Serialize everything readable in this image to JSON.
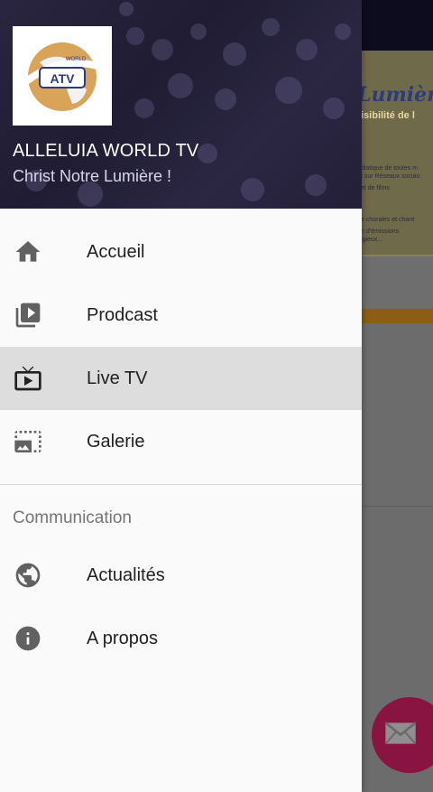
{
  "header": {
    "title": "ALLELUIA WORLD TV",
    "subtitle": "Christ Notre Lumière !",
    "logo_text": "ATV",
    "logo_small_text": "WORLD"
  },
  "menu": {
    "primary": [
      {
        "label": "Accueil",
        "icon": "home-icon"
      },
      {
        "label": "Prodcast",
        "icon": "video-library-icon"
      },
      {
        "label": "Live TV",
        "icon": "live-tv-icon",
        "active": true
      },
      {
        "label": "Galerie",
        "icon": "photo-size-select-icon"
      }
    ],
    "section_title": "Communication",
    "secondary": [
      {
        "label": "Actualités",
        "icon": "public-globe-icon"
      },
      {
        "label": "A propos",
        "icon": "info-icon"
      }
    ]
  },
  "background": {
    "banner_title": "Lumière",
    "banner_subtitle": "isibilité de l",
    "banner_lines": [
      "diatique de toutes m",
      "t sur Réseaux sociau",
      "et de films",
      "",
      "e chorales  et chant",
      "n d'émissions",
      "igieux..."
    ]
  },
  "colors": {
    "header_bg": "#231f38",
    "active_item_bg": "#dddddd",
    "fab": "#8a1441",
    "accent_orange": "#8c5d15"
  }
}
